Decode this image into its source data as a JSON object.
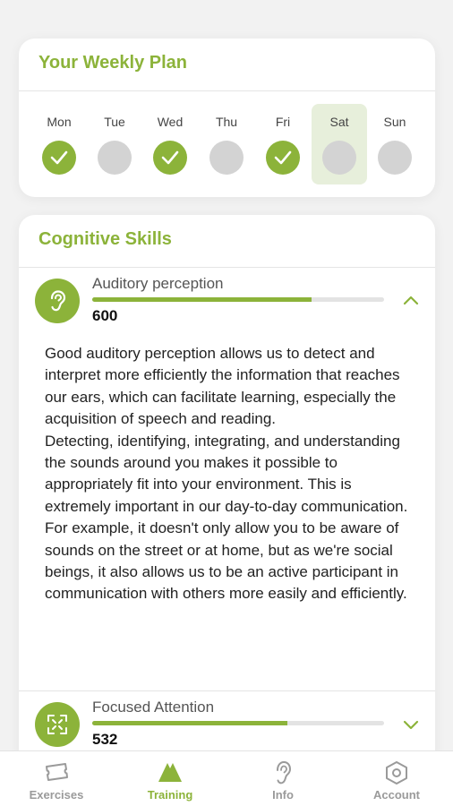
{
  "colors": {
    "accent": "#8cb33a",
    "inactive": "#d3d3d3",
    "selected_day_bg": "#e7efdb"
  },
  "weekly_plan": {
    "title": "Your Weekly Plan",
    "days": [
      {
        "label": "Mon",
        "completed": true
      },
      {
        "label": "Tue",
        "completed": false
      },
      {
        "label": "Wed",
        "completed": true
      },
      {
        "label": "Thu",
        "completed": false
      },
      {
        "label": "Fri",
        "completed": true
      },
      {
        "label": "Sat",
        "completed": false,
        "selected": true
      },
      {
        "label": "Sun",
        "completed": false
      }
    ]
  },
  "cognitive_skills": {
    "title": "Cognitive Skills",
    "skills": [
      {
        "name": "Auditory perception",
        "score": "600",
        "progress": 0.75,
        "icon": "ear-icon",
        "expanded": true,
        "description": "Good auditory perception allows us to detect and interpret more efficiently the information that reaches our ears, which can facilitate learning, especially the acquisition of speech and reading.\nDetecting, identifying, integrating, and understanding the sounds around you makes it possible to appropriately fit into your environment. This is extremely important in our day-to-day communication.\nFor example, it doesn't only allow you to be aware of sounds on the street or at home, but as we're social beings, it also allows us to be an active participant in communication with others more easily and efficiently."
      },
      {
        "name": "Focused Attention",
        "score": "532",
        "progress": 0.67,
        "icon": "focus-icon",
        "expanded": false
      }
    ]
  },
  "bottom_nav": {
    "items": [
      {
        "label": "Exercises",
        "icon": "ticket-icon",
        "active": false
      },
      {
        "label": "Training",
        "icon": "mountain-icon",
        "active": true
      },
      {
        "label": "Info",
        "icon": "ear-icon",
        "active": false
      },
      {
        "label": "Account",
        "icon": "hexagon-icon",
        "active": false
      }
    ]
  }
}
